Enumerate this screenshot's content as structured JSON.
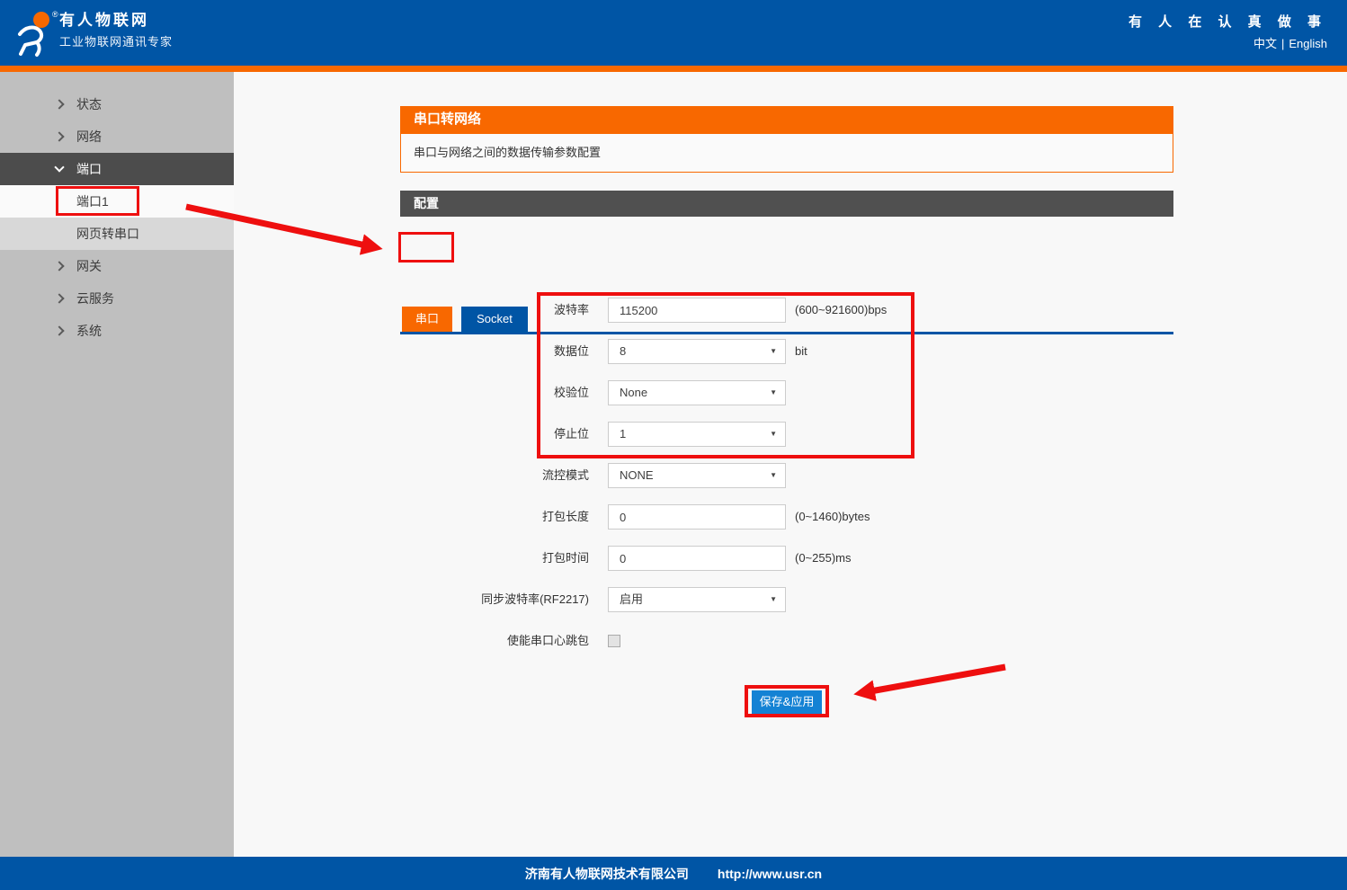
{
  "header": {
    "brand_title": "有人物联网",
    "brand_subtitle": "工业物联网通讯专家",
    "slogan": "有 人 在 认 真 做 事",
    "lang_zh": "中文",
    "lang_sep": "|",
    "lang_en": "English"
  },
  "sidebar": {
    "items": [
      {
        "label": "状态",
        "state": "collapsed"
      },
      {
        "label": "网络",
        "state": "collapsed"
      },
      {
        "label": "端口",
        "state": "expanded"
      },
      {
        "label": "端口1",
        "state": "selected-subitem"
      },
      {
        "label": "网页转串口",
        "state": "subitem"
      },
      {
        "label": "网关",
        "state": "collapsed"
      },
      {
        "label": "云服务",
        "state": "collapsed"
      },
      {
        "label": "系统",
        "state": "collapsed"
      }
    ]
  },
  "main": {
    "section_title": "串口转网络",
    "section_desc": "串口与网络之间的数据传输参数配置",
    "config_title": "配置",
    "tabs": [
      {
        "label": "串口",
        "active": true
      },
      {
        "label": "Socket",
        "active": false
      }
    ],
    "form": {
      "rows": [
        {
          "label": "波特率",
          "type": "input",
          "value": "115200",
          "hint": "(600~921600)bps"
        },
        {
          "label": "数据位",
          "type": "select",
          "value": "8",
          "hint": "bit"
        },
        {
          "label": "校验位",
          "type": "select",
          "value": "None",
          "hint": ""
        },
        {
          "label": "停止位",
          "type": "select",
          "value": "1",
          "hint": ""
        },
        {
          "label": "流控模式",
          "type": "select",
          "value": "NONE",
          "hint": ""
        },
        {
          "label": "打包长度",
          "type": "input",
          "value": "0",
          "hint": "(0~1460)bytes"
        },
        {
          "label": "打包时间",
          "type": "input",
          "value": "0",
          "hint": "(0~255)ms"
        },
        {
          "label": "同步波特率(RF2217)",
          "type": "select",
          "value": "启用",
          "hint": ""
        },
        {
          "label": "使能串口心跳包",
          "type": "checkbox",
          "value": "unchecked",
          "hint": ""
        }
      ]
    },
    "save_label": "保存&应用"
  },
  "footer": {
    "company": "济南有人物联网技术有限公司",
    "url": "http://www.usr.cn"
  },
  "colors": {
    "brand_blue": "#0055a5",
    "accent_orange": "#f86800",
    "dark_bar": "#505050",
    "sidebar_gray": "#bfbfbf",
    "save_button_blue": "#1482d4",
    "annotation_red": "#ee0f0f"
  }
}
